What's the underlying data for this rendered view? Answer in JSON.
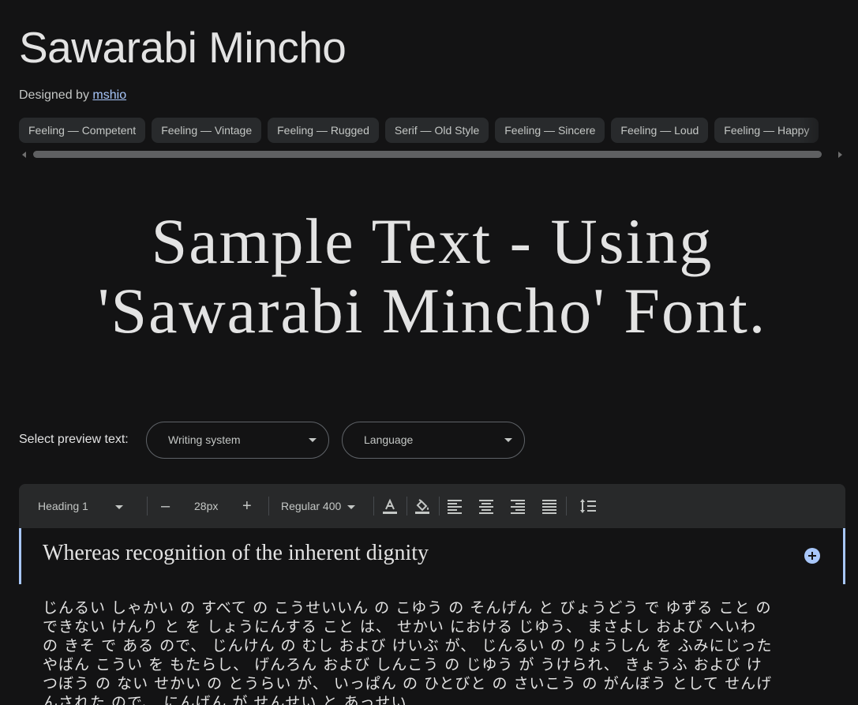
{
  "header": {
    "font_name": "Sawarabi Mincho",
    "designed_by_label": "Designed by",
    "designer": "mshio"
  },
  "tags": [
    "Feeling — Competent",
    "Feeling — Vintage",
    "Feeling — Rugged",
    "Serif — Old Style",
    "Feeling — Sincere",
    "Feeling — Loud",
    "Feeling — Happy"
  ],
  "hero": {
    "line1": "Sample Text - Using",
    "line2": "'Sawarabi Mincho' Font."
  },
  "preview_controls": {
    "label": "Select preview text:",
    "writing_system": "Writing system",
    "language": "Language"
  },
  "toolbar": {
    "style": "Heading 1",
    "decrease": "–",
    "size": "28px",
    "increase": "+",
    "weight": "Regular 400"
  },
  "preview": {
    "heading": "Whereas recognition of the inherent dignity",
    "body": "じんるい しゃかい の すべて の こうせいいん の こゆう の そんげん と びょうどう で ゆずる こと の できない けんり と を しょうにんする こと は、 せかい における じゆう、 まさよし および へいわ の きそ で ある ので、 じんけん の むし および けいぶ が、 じんるい の りょうしん を ふみにじった やばん こうい を もたらし、 げんろん および しんこう の じゆう が うけられ、 きょうふ および けつぼう の ない せかい の とうらい が、 いっぱん の ひとびと の さいこう の がんぼう として せんげんされた ので、 にんげん が せんせい と あっせい"
  }
}
